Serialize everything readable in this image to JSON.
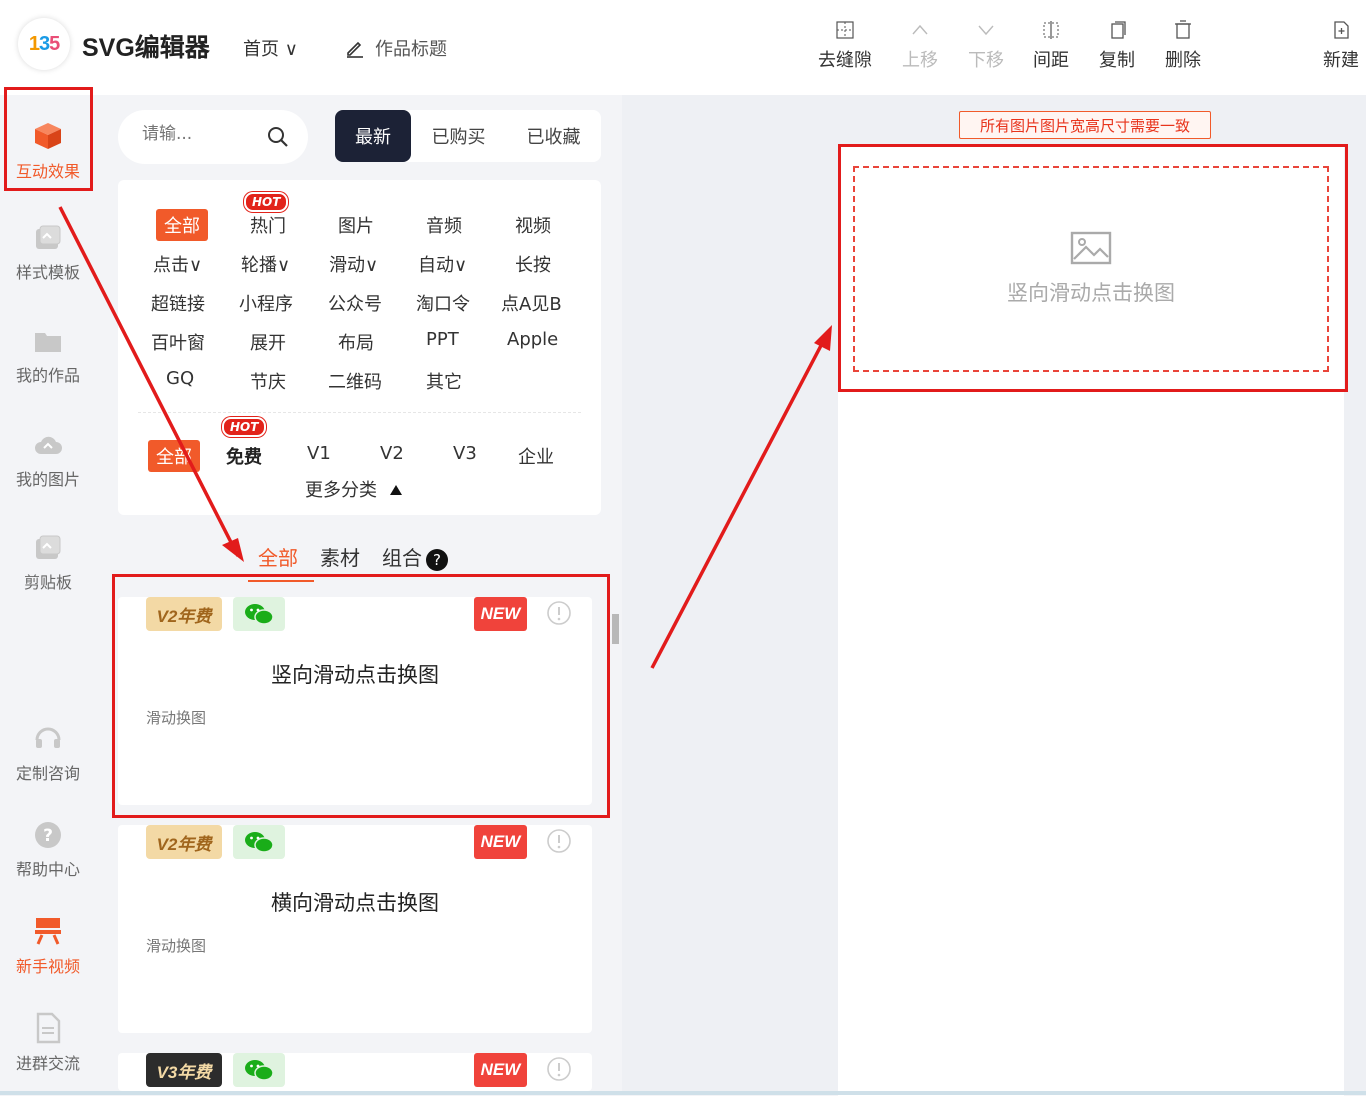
{
  "header": {
    "logo_text_1": "1",
    "logo_text_2": "3",
    "logo_text_3": "5",
    "app_title": "SVG编辑器",
    "home_menu": "首页",
    "work_title": "作品标题",
    "toolbar": [
      {
        "label": "去缝隙",
        "icon": "gap-icon",
        "enabled": true
      },
      {
        "label": "上移",
        "icon": "chevron-up-icon",
        "enabled": false
      },
      {
        "label": "下移",
        "icon": "chevron-down-icon",
        "enabled": false
      },
      {
        "label": "间距",
        "icon": "spacing-icon",
        "enabled": true
      },
      {
        "label": "复制",
        "icon": "copy-icon",
        "enabled": true
      },
      {
        "label": "删除",
        "icon": "trash-icon",
        "enabled": true
      },
      {
        "label": "新建",
        "icon": "new-file-icon",
        "enabled": true
      }
    ]
  },
  "sidebar": {
    "items": [
      {
        "label": "互动效果",
        "icon": "cube-icon",
        "active": true
      },
      {
        "label": "样式模板",
        "icon": "template-icon"
      },
      {
        "label": "我的作品",
        "icon": "folder-icon"
      },
      {
        "label": "我的图片",
        "icon": "cloud-upload-icon"
      },
      {
        "label": "剪贴板",
        "icon": "clipboard-icon"
      },
      {
        "label": "定制咨询",
        "icon": "headset-icon"
      },
      {
        "label": "帮助中心",
        "icon": "help-icon"
      },
      {
        "label": "新手视频",
        "icon": "video-icon"
      },
      {
        "label": "进群交流",
        "icon": "document-icon"
      }
    ]
  },
  "panel": {
    "search_placeholder": "请输...",
    "tabs": [
      "最新",
      "已购买",
      "已收藏"
    ],
    "categories": [
      "全部",
      "热门",
      "图片",
      "音频",
      "视频",
      "点击∨",
      "轮播∨",
      "滑动∨",
      "自动∨",
      "长按",
      "超链接",
      "小程序",
      "公众号",
      "淘口令",
      "点A见B",
      "百叶窗",
      "展开",
      "布局",
      "PPT",
      "Apple",
      "GQ",
      "节庆",
      "二维码",
      "其它"
    ],
    "hot_label": "HOT",
    "price_filters": [
      "全部",
      "免费",
      "V1",
      "V2",
      "V3",
      "企业"
    ],
    "more_label": "更多分类",
    "type_tabs": [
      "全部",
      "素材",
      "组合"
    ],
    "help_mark": "?"
  },
  "items": [
    {
      "tier": "V2年费",
      "new_label": "NEW",
      "title": "竖向滑动点击换图",
      "subtitle": "滑动换图"
    },
    {
      "tier": "V2年费",
      "new_label": "NEW",
      "title": "横向滑动点击换图",
      "subtitle": "滑动换图"
    },
    {
      "tier": "V3年费",
      "new_label": "NEW"
    }
  ],
  "canvas": {
    "notice": "所有图片图片宽高尺寸需要一致",
    "placeholder_text": "竖向滑动点击换图"
  },
  "colors": {
    "accent": "#f15a2a",
    "dark_tab": "#1c2236",
    "annotation_red": "#e21b1b"
  }
}
